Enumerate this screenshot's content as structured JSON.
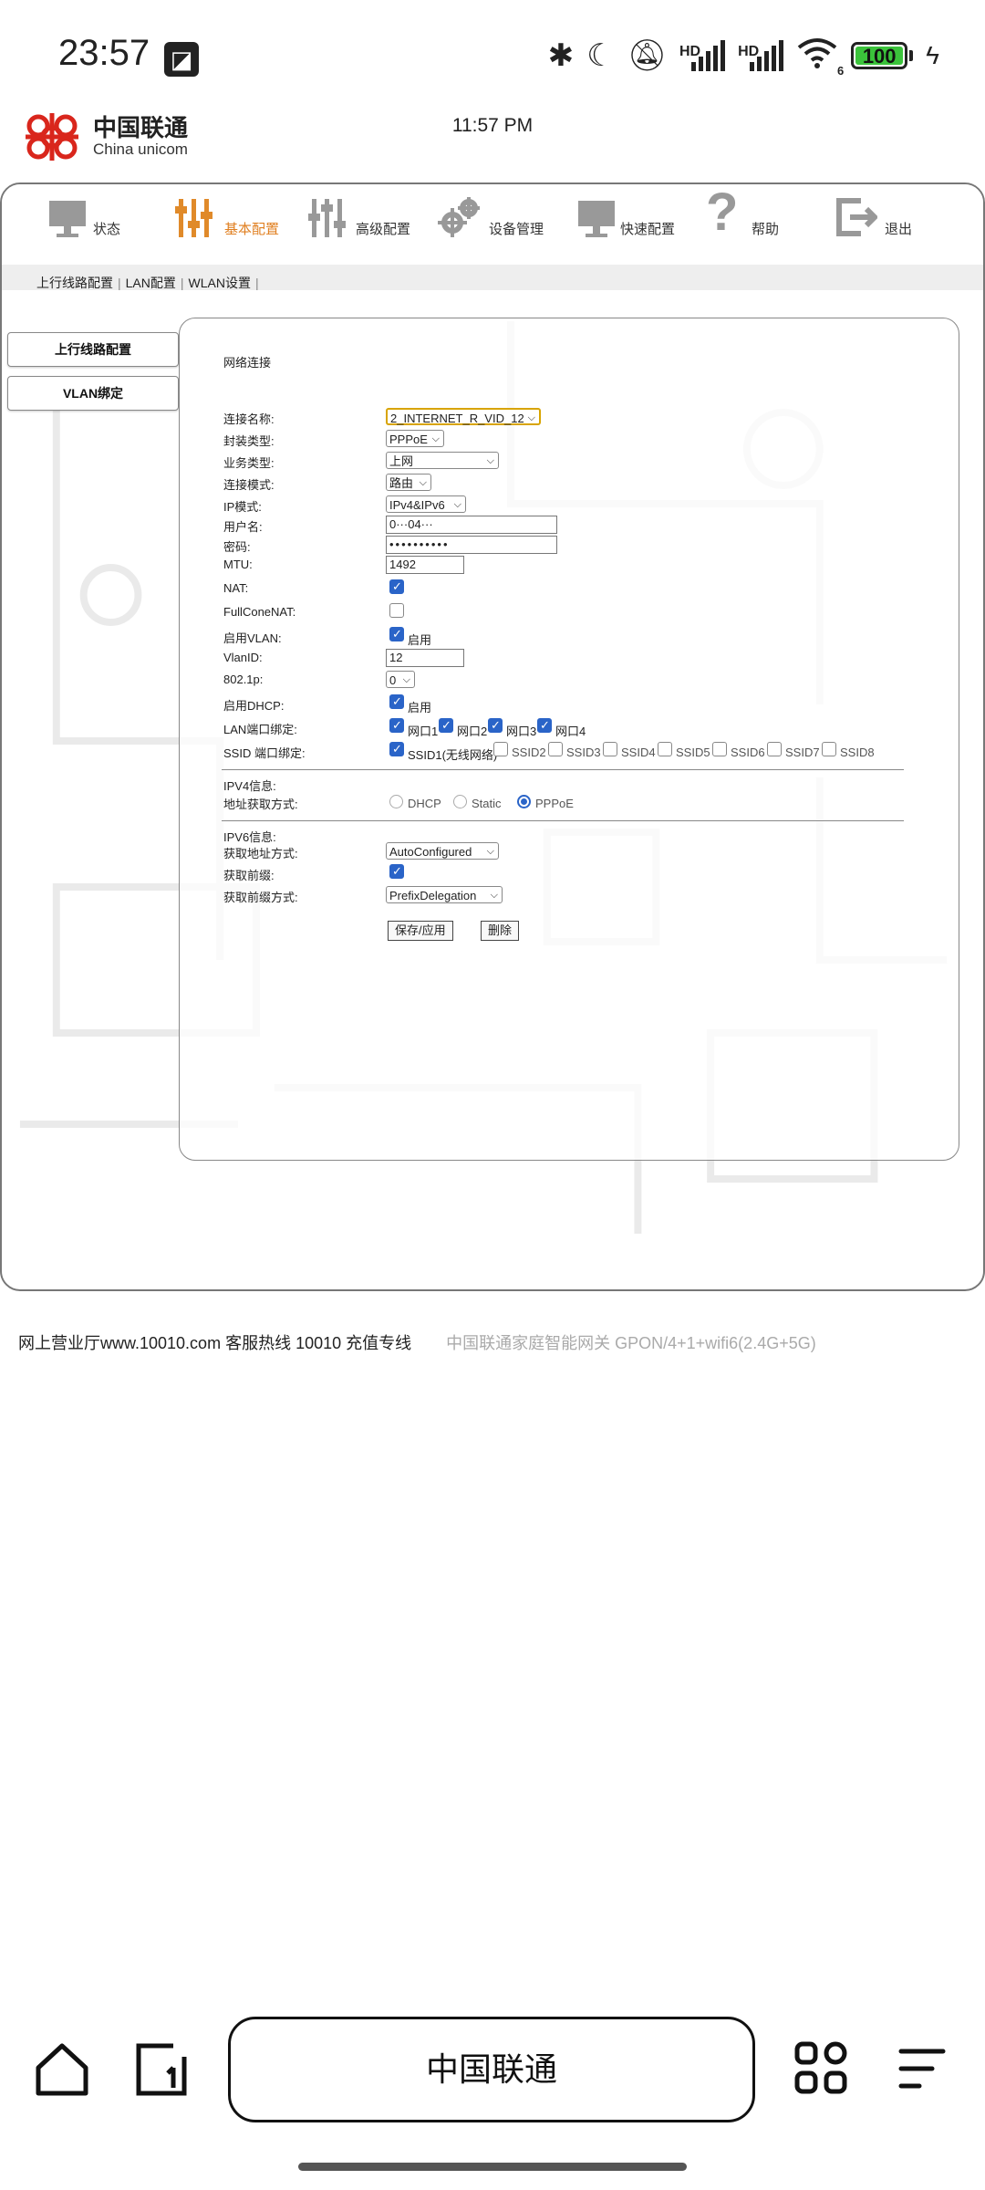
{
  "status_bar": {
    "time": "23:57",
    "battery": "100",
    "icons": [
      "bluetooth-icon",
      "moon-icon",
      "mute-bell-icon",
      "signal-hd-icon",
      "signal-hd-icon",
      "wifi-icon",
      "battery-icon",
      "charging-icon"
    ],
    "hd_label": "HD",
    "wifi_badge": "6"
  },
  "brand": {
    "name_cn": "中国联通",
    "name_en": "China unicom"
  },
  "page_time": "11:57 PM",
  "topnav": [
    {
      "label": "状态",
      "icon": "monitor-icon",
      "active": false
    },
    {
      "label": "基本配置",
      "icon": "sliders-icon",
      "active": true
    },
    {
      "label": "高级配置",
      "icon": "sliders-advanced-icon",
      "active": false
    },
    {
      "label": "设备管理",
      "icon": "gears-icon",
      "active": false
    },
    {
      "label": "快速配置",
      "icon": "monitor-icon",
      "active": false
    },
    {
      "label": "帮助",
      "icon": "question-icon",
      "active": false
    },
    {
      "label": "退出",
      "icon": "exit-icon",
      "active": false
    }
  ],
  "subnav": [
    "上行线路配置",
    "LAN配置",
    "WLAN设置"
  ],
  "sidebar": [
    "上行线路配置",
    "VLAN绑定"
  ],
  "section_title": "网络连接",
  "form": {
    "labels": {
      "conn_name": "连接名称:",
      "encap": "封装类型:",
      "service": "业务类型:",
      "conn_mode": "连接模式:",
      "ip_mode": "IP模式:",
      "username": "用户名:",
      "password": "密码:",
      "mtu": "MTU:",
      "nat": "NAT:",
      "fullcone": "FullConeNAT:",
      "vlan_enable": "启用VLAN:",
      "vlan_id": "VlanID:",
      "dot1p": "802.1p:",
      "dhcp_enable": "启用DHCP:",
      "lan_bind": "LAN端口绑定:",
      "ssid_bind": "SSID 端口绑定:"
    },
    "conn_name": "2_INTERNET_R_VID_12",
    "encap": "PPPoE",
    "service": "上网",
    "conn_mode": "路由",
    "ip_mode": "IPv4&IPv6",
    "username": "0···04···",
    "password": "••••••••••",
    "mtu": "1492",
    "nat": true,
    "fullcone": false,
    "vlan_enable": true,
    "vlan_enable_label": "启用",
    "vlan_id": "12",
    "dot1p": "0",
    "dhcp_enable": true,
    "dhcp_enable_label": "启用",
    "lan_ports": [
      {
        "label": "网口1",
        "checked": true
      },
      {
        "label": "网口2",
        "checked": true
      },
      {
        "label": "网口3",
        "checked": true
      },
      {
        "label": "网口4",
        "checked": true
      }
    ],
    "ssids": [
      {
        "label": "SSID1(无线网络)",
        "checked": true
      },
      {
        "label": "SSID2",
        "checked": false
      },
      {
        "label": "SSID3",
        "checked": false
      },
      {
        "label": "SSID4",
        "checked": false
      },
      {
        "label": "SSID5",
        "checked": false
      },
      {
        "label": "SSID6",
        "checked": false
      },
      {
        "label": "SSID7",
        "checked": false
      },
      {
        "label": "SSID8",
        "checked": false
      }
    ]
  },
  "ipv4": {
    "title": "IPV4信息:",
    "addr_label": "地址获取方式:",
    "options": [
      {
        "label": "DHCP",
        "selected": false
      },
      {
        "label": "Static",
        "selected": false
      },
      {
        "label": "PPPoE",
        "selected": true
      }
    ]
  },
  "ipv6": {
    "title": "IPV6信息:",
    "addr_label": "获取地址方式:",
    "addr_value": "AutoConfigured",
    "prefix_label": "获取前缀:",
    "prefix_checked": true,
    "prefix_mode_label": "获取前缀方式:",
    "prefix_mode_value": "PrefixDelegation"
  },
  "buttons": {
    "save": "保存/应用",
    "delete": "删除"
  },
  "footer": {
    "left": "网上营业厅www.10010.com 客服热线 10010 充值专线",
    "right": "中国联通家庭智能网关 GPON/4+1+wifi6(2.4G+5G)"
  },
  "browser": {
    "address_title": "中国联通"
  }
}
